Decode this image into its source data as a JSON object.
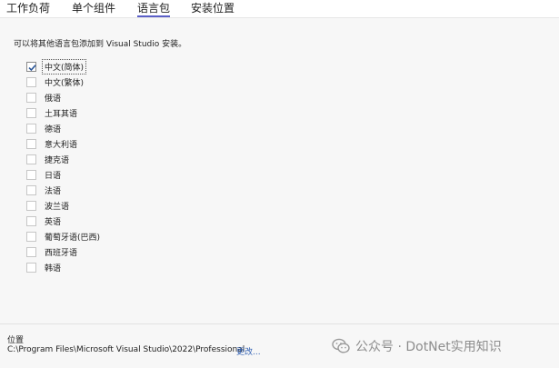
{
  "tabs": [
    {
      "label": "工作负荷",
      "active": false
    },
    {
      "label": "单个组件",
      "active": false
    },
    {
      "label": "语言包",
      "active": true
    },
    {
      "label": "安装位置",
      "active": false
    }
  ],
  "description": "可以将其他语言包添加到 Visual Studio 安装。",
  "languages": [
    {
      "label": "中文(简体)",
      "checked": true
    },
    {
      "label": "中文(繁体)",
      "checked": false
    },
    {
      "label": "俄语",
      "checked": false
    },
    {
      "label": "土耳其语",
      "checked": false
    },
    {
      "label": "德语",
      "checked": false
    },
    {
      "label": "意大利语",
      "checked": false
    },
    {
      "label": "捷克语",
      "checked": false
    },
    {
      "label": "日语",
      "checked": false
    },
    {
      "label": "法语",
      "checked": false
    },
    {
      "label": "波兰语",
      "checked": false
    },
    {
      "label": "英语",
      "checked": false
    },
    {
      "label": "葡萄牙语(巴西)",
      "checked": false
    },
    {
      "label": "西班牙语",
      "checked": false
    },
    {
      "label": "韩语",
      "checked": false
    }
  ],
  "footer": {
    "location_label": "位置",
    "location_path": "C:\\Program Files\\Microsoft Visual Studio\\2022\\Professional",
    "change_link": "更改..."
  },
  "watermark": "公众号 · DotNet实用知识",
  "colors": {
    "accent": "#5b5fc7",
    "check": "#2b579a",
    "link": "#2f5fb3"
  }
}
